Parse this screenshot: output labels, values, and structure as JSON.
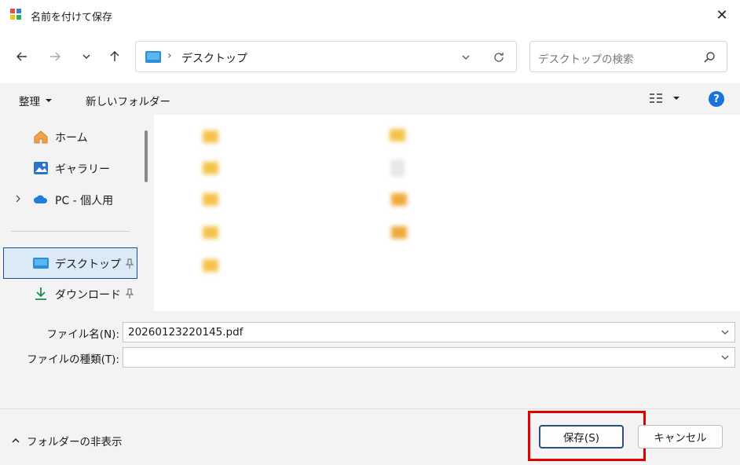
{
  "window": {
    "title": "名前を付けて保存",
    "close": "✕"
  },
  "address": {
    "path": "デスクトップ",
    "separator": "›"
  },
  "search": {
    "placeholder": "デスクトップの検索"
  },
  "toolbar": {
    "organize": "整理",
    "new_folder": "新しいフォルダー",
    "help": "?"
  },
  "sidebar": {
    "items": [
      {
        "label": "ホーム",
        "icon": "home-icon"
      },
      {
        "label": "ギャラリー",
        "icon": "gallery-icon"
      },
      {
        "label": "PC - 個人用",
        "icon": "cloud-icon"
      },
      {
        "label": "デスクトップ",
        "icon": "desktop-folder-icon",
        "selected": true
      },
      {
        "label": "ダウンロード",
        "icon": "download-icon"
      }
    ]
  },
  "form": {
    "filename_label": "ファイル名(N):",
    "filename_value": "20260123220145.pdf",
    "filetype_label": "ファイルの種類(T):",
    "filetype_value": ""
  },
  "footer": {
    "hide_folders": "フォルダーの非表示",
    "save": "保存(S)",
    "cancel": "キャンセル"
  },
  "colors": {
    "accent": "#1a73d9",
    "highlight": "#e00000",
    "folder": "#f4c24b"
  }
}
